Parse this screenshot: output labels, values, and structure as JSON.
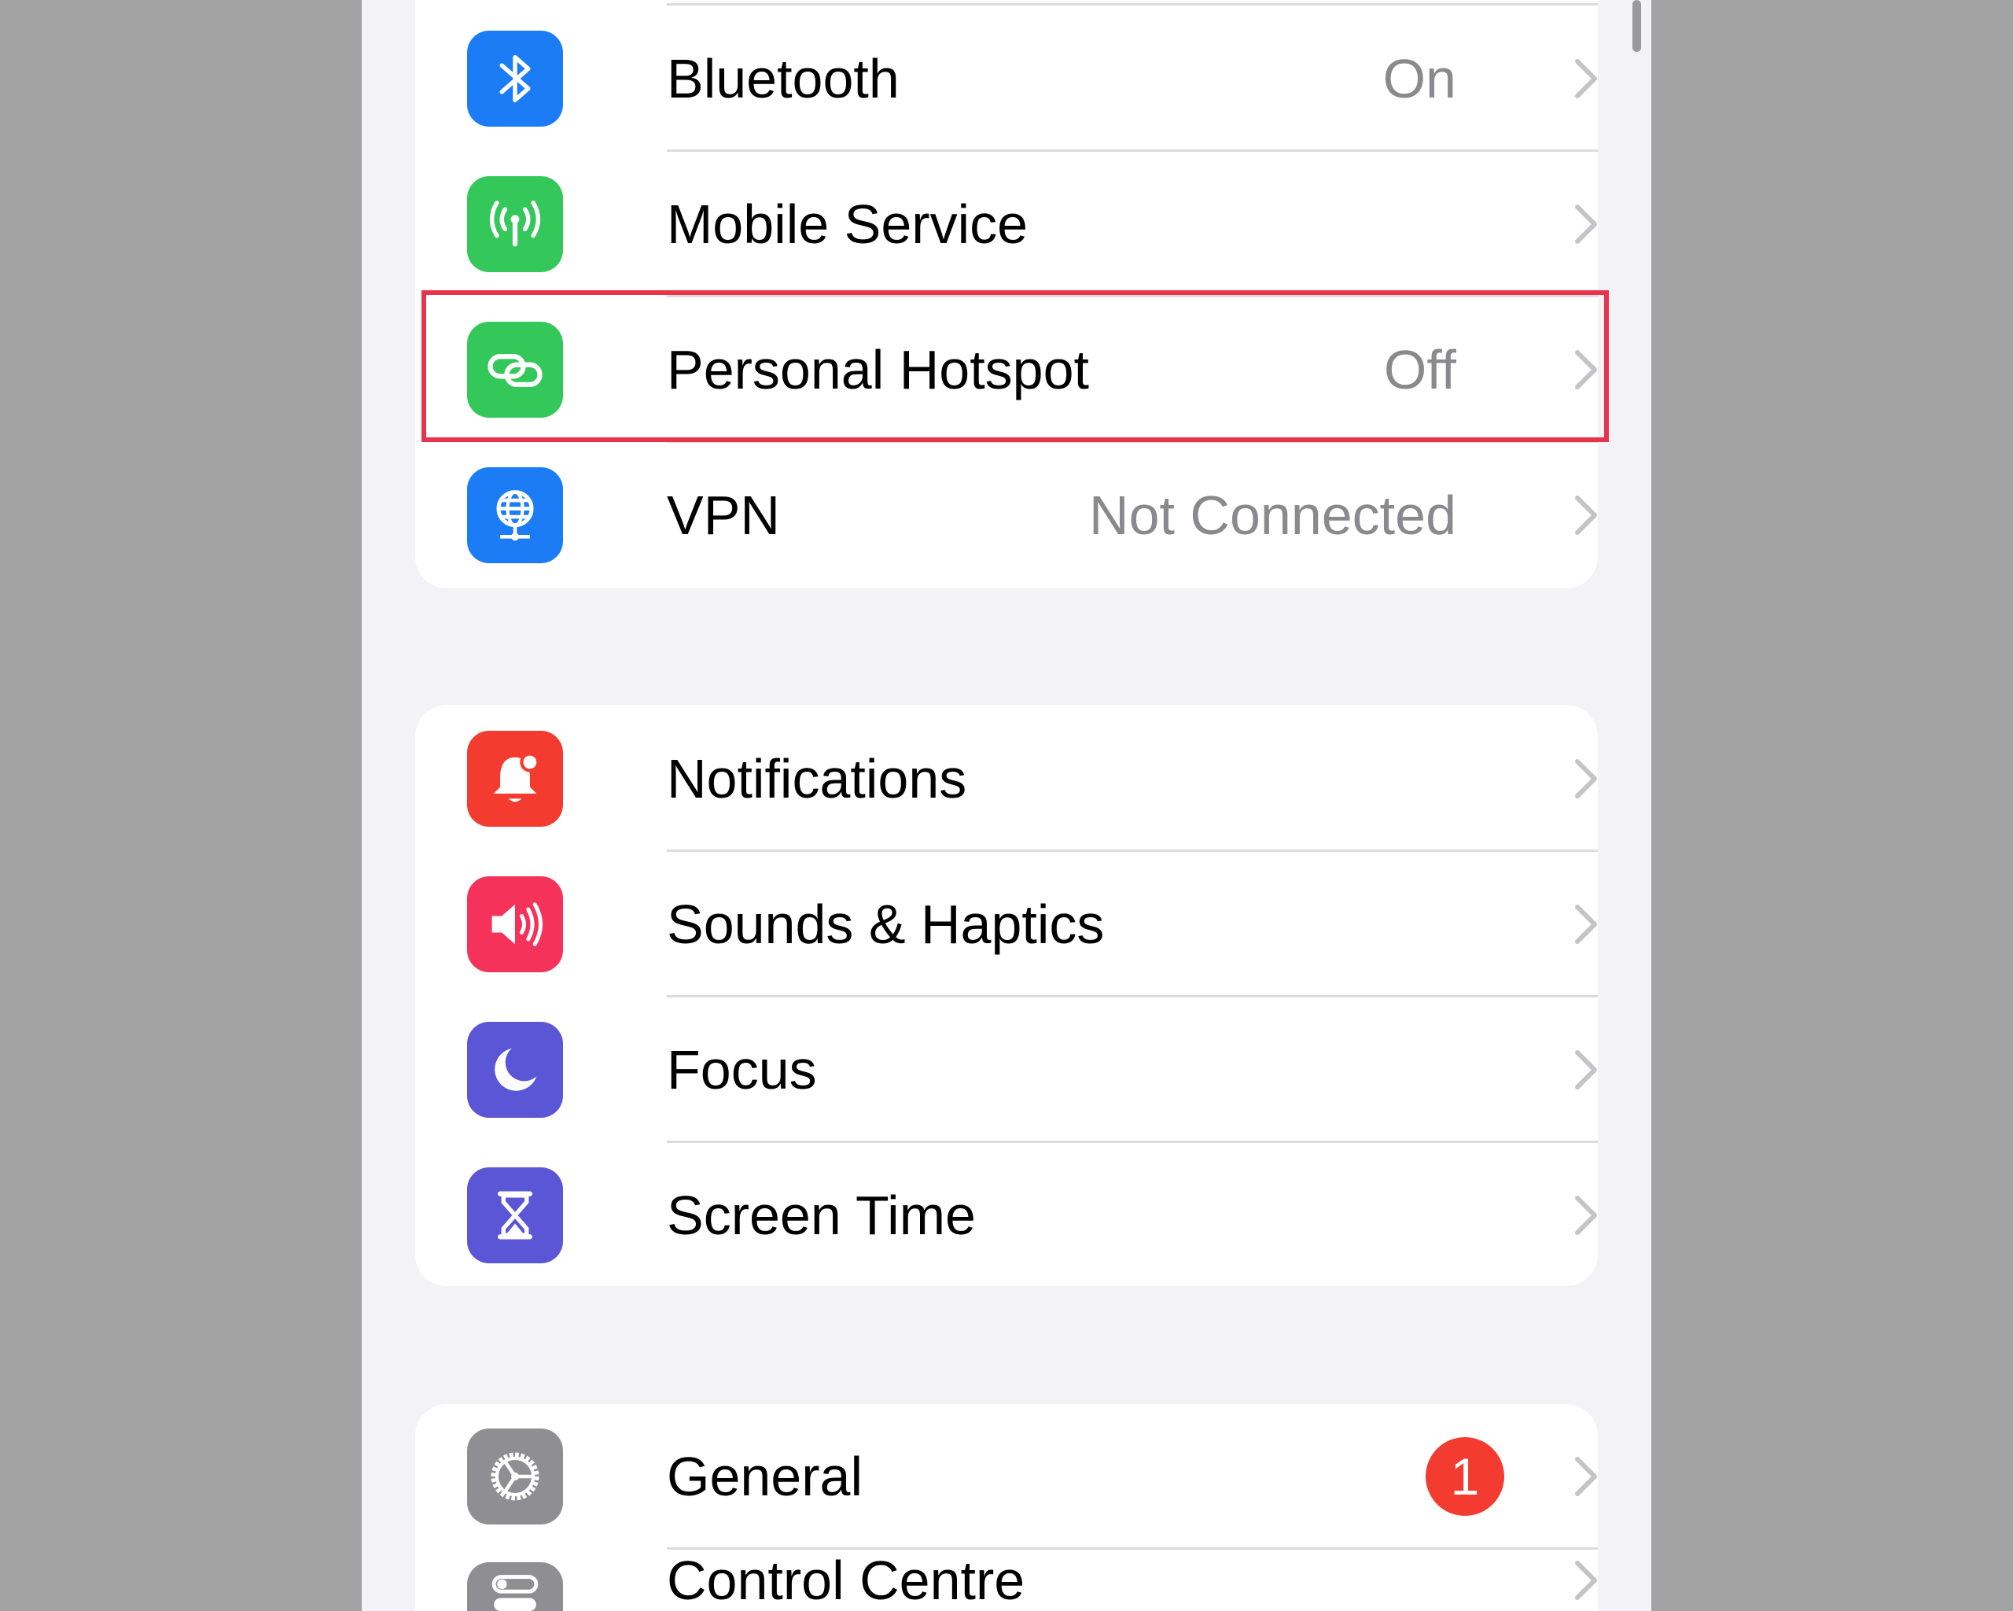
{
  "groups": [
    {
      "items": [
        {
          "label": "Bluetooth",
          "value": "On",
          "icon": "bluetooth-icon",
          "color": "#1b7cf5"
        },
        {
          "label": "Mobile Service",
          "value": "",
          "icon": "antenna-icon",
          "color": "#34c759"
        },
        {
          "label": "Personal Hotspot",
          "value": "Off",
          "icon": "link-icon",
          "color": "#34c759",
          "highlighted": true
        },
        {
          "label": "VPN",
          "value": "Not Connected",
          "icon": "globe-icon",
          "color": "#1b7cf5"
        }
      ]
    },
    {
      "items": [
        {
          "label": "Notifications",
          "value": "",
          "icon": "bell-icon",
          "color": "#f33b30"
        },
        {
          "label": "Sounds & Haptics",
          "value": "",
          "icon": "speaker-icon",
          "color": "#f5335a"
        },
        {
          "label": "Focus",
          "value": "",
          "icon": "moon-icon",
          "color": "#5a56d6"
        },
        {
          "label": "Screen Time",
          "value": "",
          "icon": "hourglass-icon",
          "color": "#5a56d6"
        }
      ]
    },
    {
      "items": [
        {
          "label": "General",
          "badge": "1",
          "icon": "gear-icon",
          "color": "#8e8e93"
        },
        {
          "label": "Control Centre",
          "icon": "switches-icon",
          "color": "#8e8e93"
        }
      ]
    }
  ],
  "highlight_color": "#e8344a"
}
